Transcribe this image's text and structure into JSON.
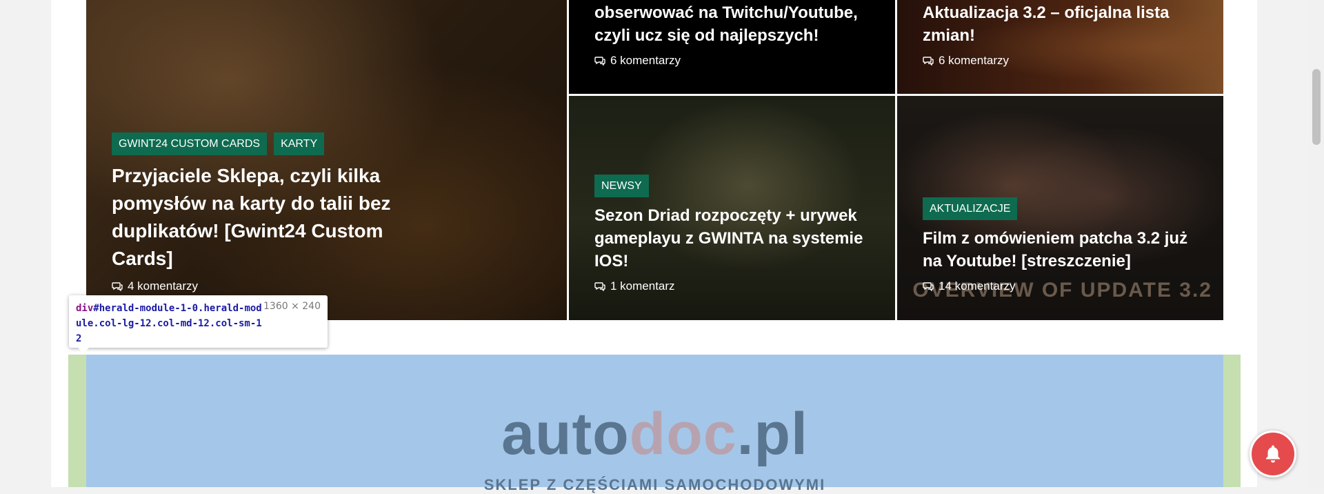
{
  "cards": [
    {
      "tags": [
        "GWINT24 CUSTOM CARDS",
        "KARTY"
      ],
      "title": "Przyjaciele Sklepa, czyli kilka pomysłów na karty do talii bez duplikatów! [Gwint24 Custom Cards]",
      "comments": "4 komentarzy"
    },
    {
      "title": "obserwować na Twitchu/Youtube, czyli ucz się od najlepszych!",
      "comments": "6 komentarzy"
    },
    {
      "title": "Aktualizacja 3.2 – oficjalna lista zmian!",
      "comments": "6 komentarzy"
    },
    {
      "tags": [
        "NEWSY"
      ],
      "title": "Sezon Driad rozpoczęty + urywek gameplayu z GWINTA na systemie IOS!",
      "comments": "1 komentarz"
    },
    {
      "tags": [
        "AKTUALIZACJE"
      ],
      "title": "Film z omówieniem patcha 3.2 już na Youtube! [streszczenie]",
      "comments": "14 komentarzy",
      "image_text": "OVERVIEW OF UPDATE 3.2"
    }
  ],
  "tooltip": {
    "tag": "div",
    "selector": "#herald-module-1-0.herald-module.col-lg-12.col-md-12.col-sm-12",
    "dims": "1360 × 240"
  },
  "ad": {
    "logo_part1": "auto",
    "logo_part2": "doc",
    "logo_part3": ".pl",
    "subtitle": "SKLEP Z CZĘŚCIAMI SAMOCHODOWYMI"
  },
  "colors": {
    "tag_bg": "#0e6b4f",
    "bell_bg": "#e54b4d",
    "module_highlight": "#c5dfb1",
    "module_content": "#a4c7e9"
  },
  "icons": {
    "comments": "comments-icon",
    "bell": "bell-icon"
  }
}
